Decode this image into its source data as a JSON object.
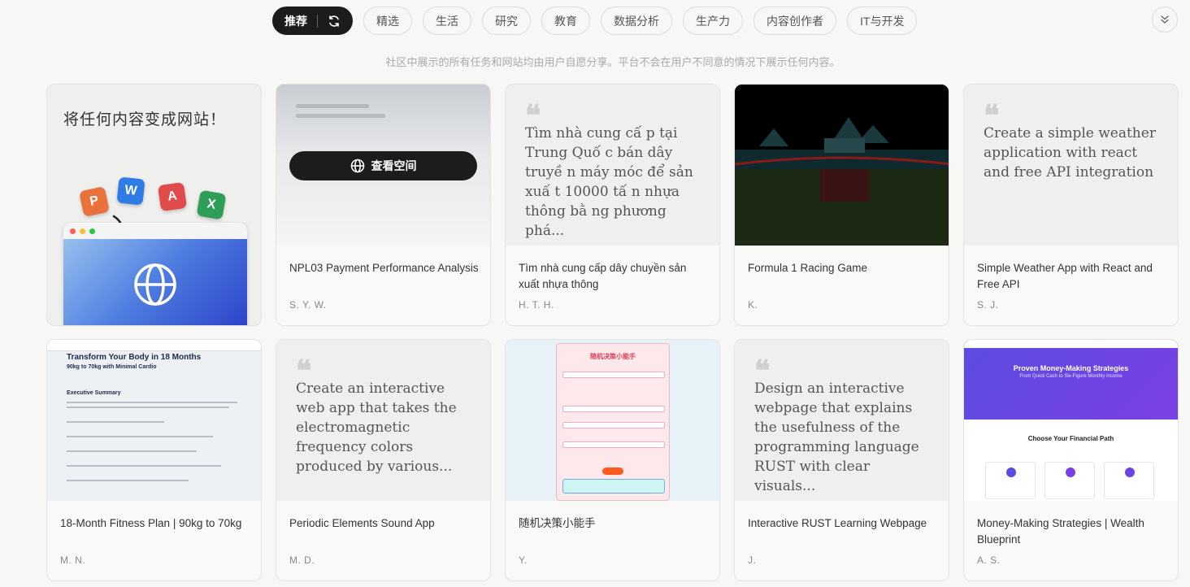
{
  "tabs": {
    "active_label": "推荐",
    "items": [
      "精选",
      "生活",
      "研究",
      "教育",
      "数据分析",
      "生产力",
      "内容创作者",
      "IT与开发"
    ]
  },
  "notice": "社区中展示的所有任务和网站均由用户自愿分享。平台不会在用户不同意的情况下展示任何内容。",
  "hero": {
    "text": "将任何内容变成网站！",
    "icons": [
      "P",
      "W",
      "A",
      "X"
    ]
  },
  "view_space_label": "查看空间",
  "cards": [
    {
      "title": "NPL03 Payment Performance Analysis",
      "author": "S. Y. W."
    },
    {
      "title": "Tìm nhà cung cấp dây chuyền sản xuất nhựa thông",
      "author": "H. T. H.",
      "quote": "Tìm nhà cung cấ p tại Trung Quố c bán dây truyề n máy móc để sản xuấ t 10000 tấ n nhựa thông bằ ng phương phá..."
    },
    {
      "title": "Formula 1 Racing Game",
      "author": "K."
    },
    {
      "title": "Simple Weather App with React and Free API",
      "author": "S. J.",
      "quote": "Create a simple weather application with react and free API integration"
    },
    {
      "title": "18-Month Fitness Plan | 90kg to 70kg",
      "author": "M. N."
    },
    {
      "title": "Periodic Elements Sound App",
      "author": "M. D.",
      "quote": "Create an interactive web app that takes the electromagnetic frequency colors produced by various..."
    },
    {
      "title": "随机决策小能手",
      "author": "Y."
    },
    {
      "title": "Interactive RUST Learning Webpage",
      "author": "J.",
      "quote": "Design an interactive webpage that explains the usefulness of the programming language RUST with clear visuals..."
    },
    {
      "title": "Money-Making Strategies | Wealth Blueprint",
      "author": "A. S."
    }
  ],
  "fitness_preview": {
    "heading": "Transform Your Body in 18 Months",
    "sub": "90kg to 70kg with Minimal Cardio",
    "section": "Executive Summary"
  },
  "decision_preview": {
    "title": "随机决策小能手"
  },
  "money_preview": {
    "heading": "Proven Money-Making Strategies",
    "sub": "From Quick Cash to Six-Figure Monthly Income",
    "choose": "Choose Your Financial Path"
  },
  "colors": {
    "active_tab": "#1c1c1c",
    "accent_purple": "#6a45e3"
  }
}
